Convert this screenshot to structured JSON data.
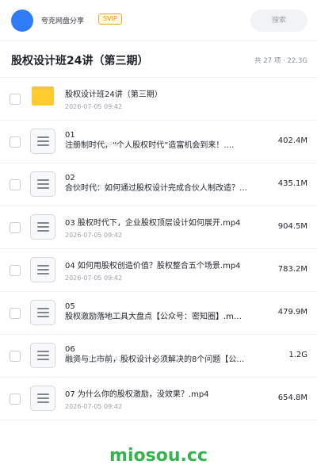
{
  "header": {
    "owner": "夸克网盘分享",
    "badge": "SVIP",
    "search_placeholder": "搜索",
    "accent_color": "#2f7cf6"
  },
  "folder": {
    "title": "股权设计班24讲（第三期）",
    "summary": "共 27 项 · 22.3G"
  },
  "items": [
    {
      "type": "folder",
      "icon": "folder-icon",
      "name": "股权设计班24讲（第三期）",
      "date": "2026-07-05 09:42",
      "size": ""
    },
    {
      "type": "file",
      "icon": "document-icon",
      "name": "01\n注册制时代，“个人股权时代”造富机会到来！.…",
      "date": "2026-07-05 09:42",
      "size": "402.4M"
    },
    {
      "type": "file",
      "icon": "document-icon",
      "name": "02\n合伙时代：如何通过股权设计完成合伙人制改造？…",
      "date": "2026-07-05 09:42",
      "size": "435.1M"
    },
    {
      "type": "file",
      "icon": "document-icon",
      "name": "03 股权时代下，企业股权顶层设计如何展开.mp4",
      "date": "2026-07-05 09:42",
      "size": "904.5M"
    },
    {
      "type": "file",
      "icon": "document-icon",
      "name": "04 如何用股权创造价值？股权整合五个场景.mp4",
      "date": "2026-07-05 09:42",
      "size": "783.2M"
    },
    {
      "type": "file",
      "icon": "document-icon",
      "name": "05\n股权激励落地工具大盘点【公众号：密知圈】.m…",
      "date": "2026-07-05 09:42",
      "size": "479.9M"
    },
    {
      "type": "file",
      "icon": "document-icon",
      "name": "06\n融资与上市前，股权设计必须解决的8个问题【公…",
      "date": "2026-07-05 09:42",
      "size": "1.2G"
    },
    {
      "type": "file",
      "icon": "document-icon",
      "name": "07 为什么你的股权激励，没效果？.mp4",
      "date": "2026-07-05 09:42",
      "size": "654.8M"
    }
  ],
  "watermark": "miosou.cc"
}
